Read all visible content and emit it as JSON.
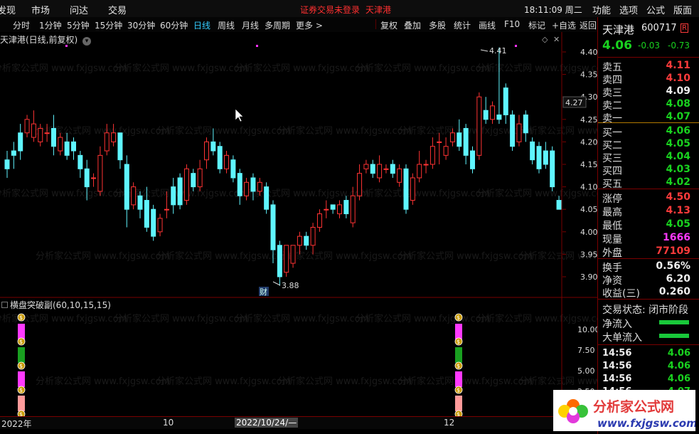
{
  "topbar": {
    "menus": [
      "发现",
      "市场",
      "问达",
      "交易"
    ],
    "warning": "证券交易未登录",
    "stock_name": "天津港",
    "clock": "18:11:09 周二",
    "right_menus": [
      "功能",
      "选项",
      "公式",
      "版面"
    ]
  },
  "toolbar": {
    "periods": [
      "分时",
      "1分钟",
      "5分钟",
      "15分钟",
      "30分钟",
      "60分钟",
      "日线",
      "周线",
      "月线",
      "多周期",
      "更多 >"
    ],
    "active_period": "日线",
    "tools": [
      "复权",
      "叠加",
      "多股",
      "统计",
      "画线",
      "F10",
      "标记",
      "+自选",
      "返回"
    ]
  },
  "chart": {
    "title": "天津港(日线,前复权)",
    "price_axis": [
      "4.40",
      "4.35",
      "4.30",
      "4.25",
      "4.20",
      "4.15",
      "4.10",
      "4.05",
      "4.00",
      "3.95",
      "3.90"
    ],
    "current_price_tag": "4.27",
    "high_marker": "4.41",
    "low_marker": "3.88",
    "event_marker": "财",
    "colors": {
      "up": "#ff3333",
      "down": "#5ff5ff",
      "background": "#000000"
    }
  },
  "indicator": {
    "title": "横盘突破副(60,10,15,15)",
    "axis": [
      "10.00",
      "7.50",
      "5.00",
      "2.50"
    ]
  },
  "time_axis": {
    "labels": [
      "2022年",
      "10",
      "2022/10/24/—",
      "12"
    ]
  },
  "quote_panel": {
    "name": "天津港",
    "code": "600717",
    "code_badge": "R",
    "price": "4.06",
    "change": "-0.03",
    "change_pct": "-0.73",
    "asks": [
      {
        "label": "卖五",
        "price": "4.11",
        "color": "red"
      },
      {
        "label": "卖四",
        "price": "4.10",
        "color": "red"
      },
      {
        "label": "卖三",
        "price": "4.09",
        "color": "white"
      },
      {
        "label": "卖二",
        "price": "4.08",
        "color": "green"
      },
      {
        "label": "卖一",
        "price": "4.07",
        "color": "green"
      }
    ],
    "bids": [
      {
        "label": "买一",
        "price": "4.06",
        "color": "green"
      },
      {
        "label": "买二",
        "price": "4.05",
        "color": "green"
      },
      {
        "label": "买三",
        "price": "4.04",
        "color": "green"
      },
      {
        "label": "买四",
        "price": "4.03",
        "color": "green"
      },
      {
        "label": "买五",
        "price": "4.02",
        "color": "green"
      }
    ],
    "stats": [
      {
        "label": "涨停",
        "value": "4.50",
        "color": "red"
      },
      {
        "label": "最高",
        "value": "4.13",
        "color": "red"
      },
      {
        "label": "最低",
        "value": "4.05",
        "color": "green"
      },
      {
        "label": "现量",
        "value": "1666",
        "color": "mag"
      },
      {
        "label": "外盘",
        "value": "77109",
        "color": "red"
      }
    ],
    "ratios": [
      {
        "label": "换手",
        "value": "0.56%"
      },
      {
        "label": "净资",
        "value": "6.20"
      },
      {
        "label": "收益(三)",
        "value": "0.260"
      }
    ],
    "trade_status": "交易状态: 闭市阶段",
    "net_inflow": "净流入",
    "big_inflow": "大单流入",
    "ticks": [
      {
        "time": "14:56",
        "price": "4.06"
      },
      {
        "time": "14:56",
        "price": "4.06"
      },
      {
        "time": "14:56",
        "price": "4.06"
      },
      {
        "time": "14:56",
        "price": "4.07"
      }
    ]
  },
  "watermark": {
    "logo_text": "分析家公式网",
    "url": "www.fxjgsw.com"
  }
}
